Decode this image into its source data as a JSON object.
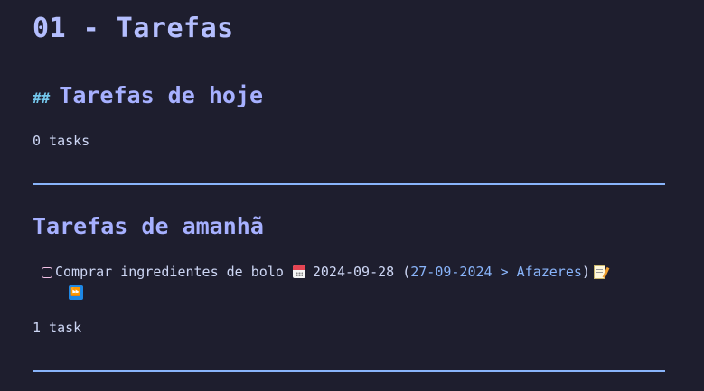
{
  "page": {
    "title": "01 - Tarefas"
  },
  "section_today": {
    "heading_marker": "##",
    "heading": "Tarefas de hoje",
    "count_text": "0 tasks"
  },
  "section_tomorrow": {
    "heading": "Tarefas de amanhã",
    "task": {
      "checked": false,
      "text": "Comprar ingredientes de bolo",
      "due_icon": "calendar-icon",
      "due_date": "2024-09-28",
      "source_open": "(",
      "source_link": "27-09-2024 > Afazeres",
      "source_close": ")",
      "edit_icon": "memo-icon",
      "priority_icon": "fast-forward-icon"
    },
    "count_text": "1 task"
  },
  "colors": {
    "background": "#1e1e2e",
    "title": "#b4befe",
    "heading": "#a6b0ff",
    "rule": "#89b4fa",
    "link": "#89b4fa",
    "checkbox_border": "#f5c2e7"
  }
}
